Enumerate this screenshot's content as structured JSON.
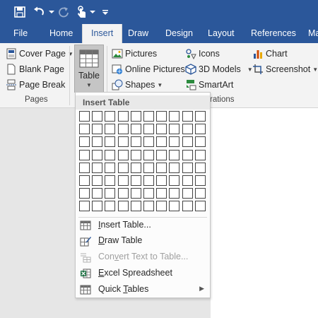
{
  "qat": {
    "save": "save-icon",
    "undo": "undo-icon",
    "redo": "redo-icon",
    "touch": "touch-mode-icon",
    "customize": "customize-qat-icon"
  },
  "tabs": [
    {
      "label": "File"
    },
    {
      "label": "Home"
    },
    {
      "label": "Insert"
    },
    {
      "label": "Draw"
    },
    {
      "label": "Design"
    },
    {
      "label": "Layout"
    },
    {
      "label": "References"
    },
    {
      "label": "Ma"
    }
  ],
  "ribbon": {
    "pages": {
      "cover_page": "Cover Page",
      "blank_page": "Blank Page",
      "page_break": "Page Break",
      "group_label": "Pages"
    },
    "table": {
      "label": "Table"
    },
    "illustrations": {
      "pictures": "Pictures",
      "online_pictures": "Online Pictures",
      "shapes": "Shapes",
      "icons": "Icons",
      "models_3d": "3D Models",
      "smartart": "SmartArt",
      "chart": "Chart",
      "screenshot": "Screenshot",
      "group_label": "rations"
    }
  },
  "dropdown": {
    "header": "Insert Table",
    "grid": {
      "cols": 10,
      "rows": 8
    },
    "items": [
      {
        "prefix": "",
        "mnemonic": "I",
        "rest": "nsert Table...",
        "disabled": false
      },
      {
        "prefix": "",
        "mnemonic": "D",
        "rest": "raw Table",
        "disabled": false
      },
      {
        "prefix": "Con",
        "mnemonic": "v",
        "rest": "ert Text to Table...",
        "disabled": true
      },
      {
        "prefix": "",
        "mnemonic": "E",
        "rest": "xcel Spreadsheet",
        "disabled": false
      },
      {
        "prefix": "Quick ",
        "mnemonic": "T",
        "rest": "ables",
        "disabled": false
      }
    ]
  },
  "colors": {
    "accent": "#2b579a",
    "ribbon_bg": "#f3f3f3",
    "workspace_bg": "#e6e6e6"
  }
}
